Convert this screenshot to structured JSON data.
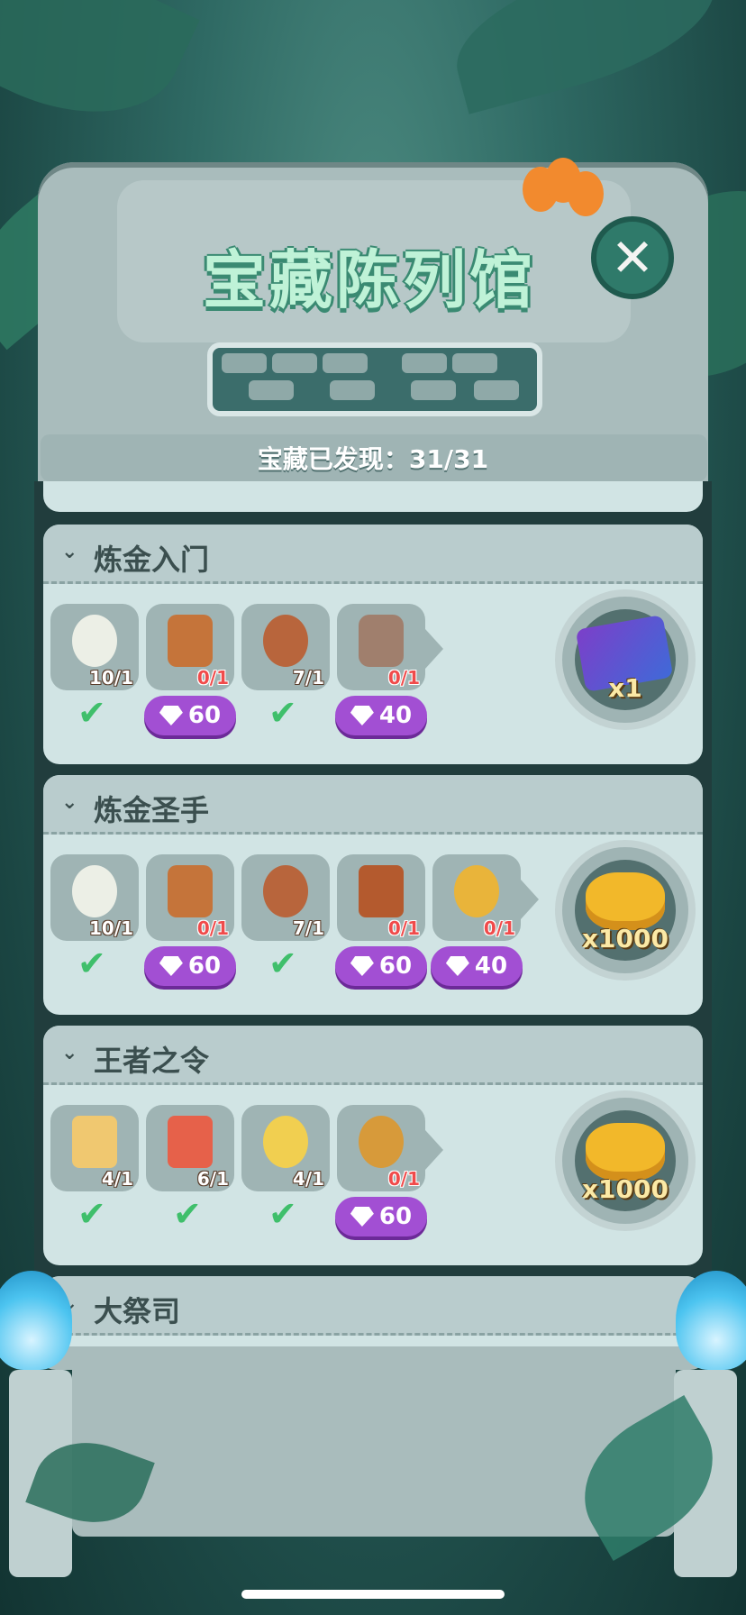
{
  "header": {
    "title": "宝藏陈列馆",
    "close_icon": "close-icon",
    "counter_label": "宝藏已发现：31/31"
  },
  "cards": [
    {
      "name": "炼金入门",
      "items": [
        {
          "icon": "bone-ring-icon",
          "count": "10/1",
          "status": "done"
        },
        {
          "icon": "totem-mask-icon",
          "count": "0/1",
          "status": "buy",
          "price": "60"
        },
        {
          "icon": "tribal-shield-icon",
          "count": "7/1",
          "status": "done"
        },
        {
          "icon": "stone-fossil-icon",
          "count": "0/1",
          "status": "buy",
          "price": "40"
        }
      ],
      "reward": {
        "type": "mickey-ticket",
        "qty": "x1"
      }
    },
    {
      "name": "炼金圣手",
      "items": [
        {
          "icon": "bone-ring-icon",
          "count": "10/1",
          "status": "done"
        },
        {
          "icon": "totem-mask-icon",
          "count": "0/1",
          "status": "buy",
          "price": "60"
        },
        {
          "icon": "tribal-shield-icon",
          "count": "7/1",
          "status": "done"
        },
        {
          "icon": "leather-book-icon",
          "count": "0/1",
          "status": "buy",
          "price": "60"
        },
        {
          "icon": "gold-trophy-icon",
          "count": "0/1",
          "status": "buy",
          "price": "40"
        }
      ],
      "reward": {
        "type": "gold-coins",
        "qty": "x1000"
      }
    },
    {
      "name": "王者之令",
      "items": [
        {
          "icon": "golden-crown-icon",
          "count": "4/1",
          "status": "done"
        },
        {
          "icon": "mickey-scroll-icon",
          "count": "6/1",
          "status": "done"
        },
        {
          "icon": "mickey-scepter-icon",
          "count": "4/1",
          "status": "done"
        },
        {
          "icon": "mickey-medallion-icon",
          "count": "0/1",
          "status": "buy",
          "price": "60"
        }
      ],
      "reward": {
        "type": "gold-coins",
        "qty": "x1000"
      }
    },
    {
      "name": "大祭司",
      "items": [],
      "reward": null
    }
  ],
  "colors": {
    "gem_button": "#a24fd3",
    "check": "#3fbf6b",
    "count_missing": "#f04b4b",
    "title_text": "#bff2d7"
  }
}
